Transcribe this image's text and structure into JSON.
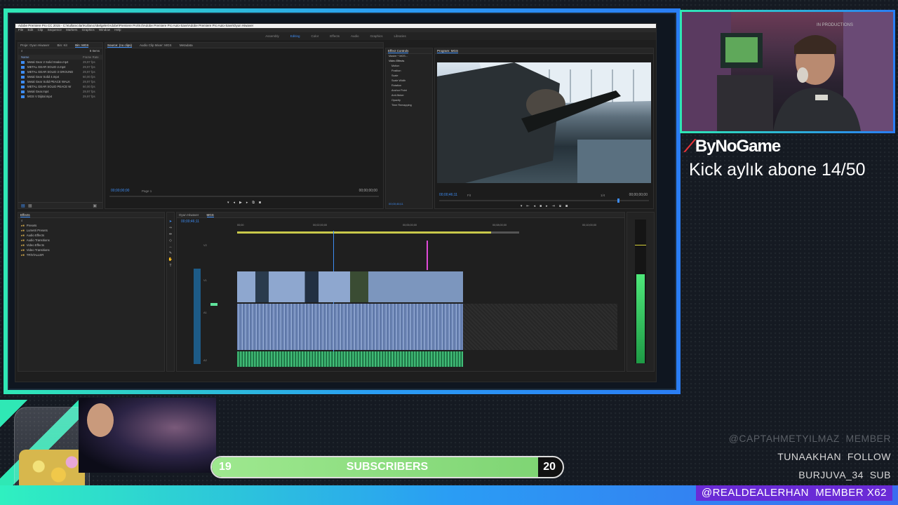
{
  "premiere": {
    "title_bar": "Adobe Premiere Pro CC 2015 - C:\\Kullanıcılar\\Kullanıcı\\Belgeler\\Adobe\\Premiere Pro\\9.0\\Adobe Premiere Pro Auto-Save\\Adobe Premiere Pro Auto-Save\\Oyun Hiwaver",
    "menu": [
      "File",
      "Edit",
      "Clip",
      "Sequence",
      "Markers",
      "Graphics",
      "Window",
      "Help"
    ],
    "workspaces": [
      "Assembly",
      "Editing",
      "Color",
      "Effects",
      "Audio",
      "Graphics",
      "Libraries"
    ],
    "active_workspace": "Editing",
    "project_panel": {
      "tabs": [
        "Proje: Oyun Hiwaver",
        "Bin: Kit",
        "Bin: MGS"
      ],
      "columns": {
        "name": "Name",
        "frame_rate": "Frame Rate"
      },
      "items_count": "8 Items",
      "items": [
        {
          "name": "Metal Gear 2 Solid Snake.mp4",
          "fps": "29,97 fps"
        },
        {
          "name": "METAL GEAR SOLID 2.mp4",
          "fps": "29,97 fps"
        },
        {
          "name": "METAL GEAR SOLID 3 GROUND",
          "fps": "29,97 fps"
        },
        {
          "name": "Metal Gear Solid 4.mp4",
          "fps": "60,00 fps"
        },
        {
          "name": "Metal Gear Solid PEACE WALK",
          "fps": "29,97 fps"
        },
        {
          "name": "METAL GEAR SOLID PEACE W",
          "fps": "60,00 fps"
        },
        {
          "name": "Metal Gear.mp4",
          "fps": "29,97 fps"
        },
        {
          "name": "MGS V Dijital.mp4",
          "fps": "29,97 fps"
        }
      ]
    },
    "source_panel": {
      "tabs": [
        "Source: (no clips)",
        "Audio Clip Mixer: MGS",
        "Metadata"
      ],
      "timecode_left": "00;00;00;00",
      "timecode_right": "00;00;00;00",
      "page": "Page 1"
    },
    "effect_controls": {
      "tab": "Effect Controls",
      "master": "Master * MGS...",
      "video_effects": "Video Effects",
      "items": [
        "Motion",
        "Position",
        "Scale",
        "Scale Width",
        "Rotation",
        "Anchor Point",
        "Anti-flicker",
        "Opacity",
        "Time Remapping"
      ],
      "timecode": "00;00;46;11"
    },
    "program_panel": {
      "tab": "Program: MGS",
      "timecode_left": "00;00;46;11",
      "fit": "Fit",
      "zoom": "1/4",
      "timecode_right": "00;00;00;00"
    },
    "effects_panel": {
      "tab": "Effects",
      "folders": [
        "Presets",
        "Lumetri Presets",
        "Audio Effects",
        "Audio Transitions",
        "Video Effects",
        "Video Transitions",
        "TRİVİALLER"
      ]
    },
    "timeline": {
      "tabs": [
        "Oyun Hiwaver",
        "MGS"
      ],
      "timecode": "00;00;46;11",
      "ruler": [
        "00;00",
        "00;02;00;00",
        "00;05;00;00",
        "00;08;00;00",
        "00;10;00;00"
      ],
      "tracks": [
        "V2",
        "V1",
        "A1",
        "A2"
      ]
    },
    "meter_level": 0.62
  },
  "overlay": {
    "brand": "ByNoGame",
    "goal_text": "Kick aylık abone 14/50",
    "subscribers_label": "SUBSCRIBERS",
    "subscribers_start": "19",
    "subscribers_end": "20",
    "subscribers_progress": 0.93,
    "ticker": [
      {
        "name": "@CAPTAHMETYILMAZ",
        "action": "MEMBER"
      },
      {
        "name": "TUNAAKHAN",
        "action": "FOLLOW"
      },
      {
        "name": "BURJUVA_34",
        "action": "SUB"
      }
    ],
    "member_highlight": {
      "name": "@REALDEALERHAN",
      "action": "MEMBER X62"
    },
    "cam_label": "IN PRODUCTIONS",
    "accent_colors": {
      "teal": "#2fe8b5",
      "blue": "#2a7df4",
      "purple": "#6a2bd6"
    }
  }
}
